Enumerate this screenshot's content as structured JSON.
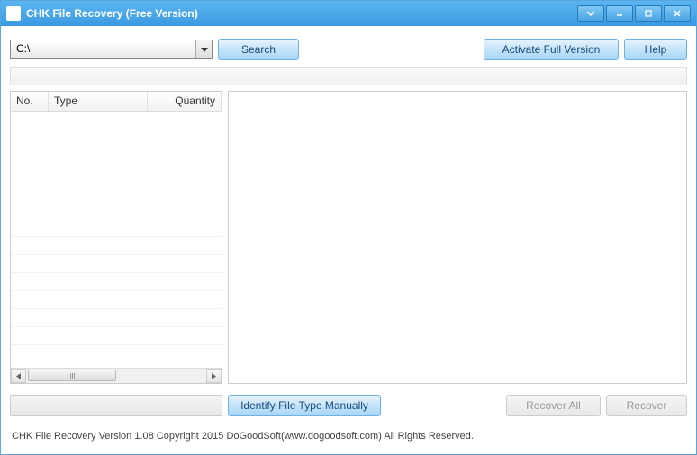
{
  "window": {
    "title": "CHK File Recovery (Free Version)"
  },
  "toolbar": {
    "drive_selected": "C:\\",
    "search_label": "Search",
    "activate_label": "Activate Full Version",
    "help_label": "Help"
  },
  "table": {
    "columns": {
      "no": "No.",
      "type": "Type",
      "quantity": "Quantity"
    },
    "rows": []
  },
  "bottom": {
    "identify_label": "Identify File Type Manually",
    "recover_all_label": "Recover All",
    "recover_label": "Recover"
  },
  "footer": {
    "text": "CHK File Recovery Version 1.08   Copyright 2015 DoGoodSoft(www.dogoodsoft.com) All Rights Reserved."
  }
}
